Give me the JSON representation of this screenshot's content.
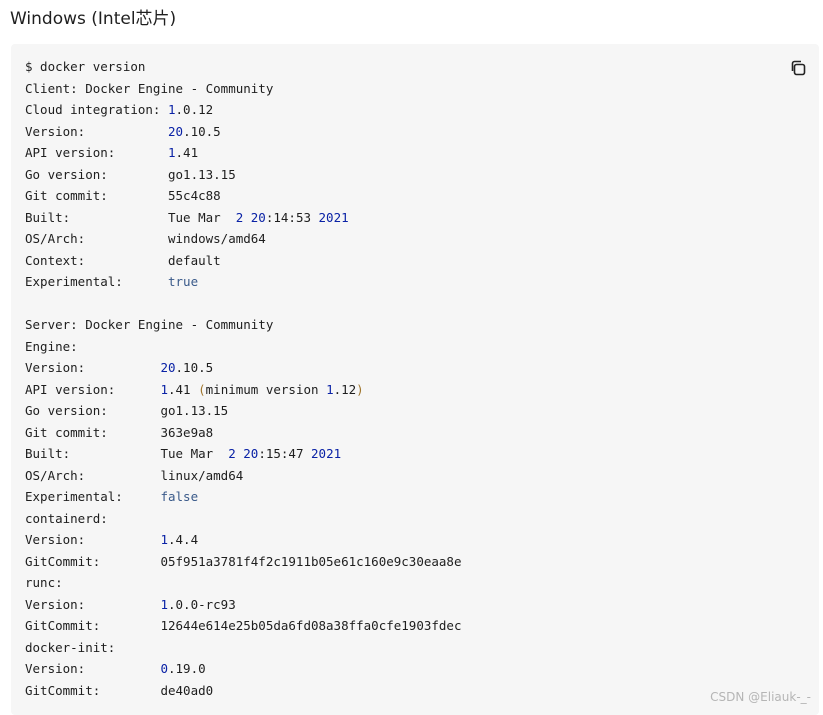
{
  "heading": "Windows (Intel芯片)",
  "copy_icon": "copy-icon",
  "colors": {
    "number": "#0a22a6",
    "boolean": "#3a5a8a",
    "paren": "#a0762d",
    "code_background": "#f6f6f6"
  },
  "code_lines": [
    [
      {
        "t": "$ docker version"
      }
    ],
    [
      {
        "t": "Client: Docker Engine - Community"
      }
    ],
    [
      {
        "t": "Cloud integration: "
      },
      {
        "t": "1",
        "k": "num"
      },
      {
        "t": ".0.12"
      }
    ],
    [
      {
        "t": "Version:           "
      },
      {
        "t": "20",
        "k": "num"
      },
      {
        "t": ".10.5"
      }
    ],
    [
      {
        "t": "API version:       "
      },
      {
        "t": "1",
        "k": "num"
      },
      {
        "t": ".41"
      }
    ],
    [
      {
        "t": "Go version:        go1.13.15"
      }
    ],
    [
      {
        "t": "Git commit:        55c4c88"
      }
    ],
    [
      {
        "t": "Built:             Tue Mar  "
      },
      {
        "t": "2",
        "k": "num"
      },
      {
        "t": " "
      },
      {
        "t": "20",
        "k": "num"
      },
      {
        "t": ":14:53 "
      },
      {
        "t": "2021",
        "k": "num"
      }
    ],
    [
      {
        "t": "OS/Arch:           windows/amd64"
      }
    ],
    [
      {
        "t": "Context:           default"
      }
    ],
    [
      {
        "t": "Experimental:      "
      },
      {
        "t": "true",
        "k": "bool"
      }
    ],
    [
      {
        "t": ""
      }
    ],
    [
      {
        "t": "Server: Docker Engine - Community"
      }
    ],
    [
      {
        "t": "Engine:"
      }
    ],
    [
      {
        "t": "Version:          "
      },
      {
        "t": "20",
        "k": "num"
      },
      {
        "t": ".10.5"
      }
    ],
    [
      {
        "t": "API version:      "
      },
      {
        "t": "1",
        "k": "num"
      },
      {
        "t": ".41 "
      },
      {
        "t": "(",
        "k": "paren"
      },
      {
        "t": "minimum version "
      },
      {
        "t": "1",
        "k": "num"
      },
      {
        "t": ".12"
      },
      {
        "t": ")",
        "k": "paren"
      }
    ],
    [
      {
        "t": "Go version:       go1.13.15"
      }
    ],
    [
      {
        "t": "Git commit:       363e9a8"
      }
    ],
    [
      {
        "t": "Built:            Tue Mar  "
      },
      {
        "t": "2",
        "k": "num"
      },
      {
        "t": " "
      },
      {
        "t": "20",
        "k": "num"
      },
      {
        "t": ":15:47 "
      },
      {
        "t": "2021",
        "k": "num"
      }
    ],
    [
      {
        "t": "OS/Arch:          linux/amd64"
      }
    ],
    [
      {
        "t": "Experimental:     "
      },
      {
        "t": "false",
        "k": "bool"
      }
    ],
    [
      {
        "t": "containerd:"
      }
    ],
    [
      {
        "t": "Version:          "
      },
      {
        "t": "1",
        "k": "num"
      },
      {
        "t": ".4.4"
      }
    ],
    [
      {
        "t": "GitCommit:        05f951a3781f4f2c1911b05e61c160e9c30eaa8e"
      }
    ],
    [
      {
        "t": "runc:"
      }
    ],
    [
      {
        "t": "Version:          "
      },
      {
        "t": "1",
        "k": "num"
      },
      {
        "t": ".0.0-rc93"
      }
    ],
    [
      {
        "t": "GitCommit:        12644e614e25b05da6fd08a38ffa0cfe1903fdec"
      }
    ],
    [
      {
        "t": "docker-init:"
      }
    ],
    [
      {
        "t": "Version:          "
      },
      {
        "t": "0",
        "k": "num"
      },
      {
        "t": ".19.0"
      }
    ],
    [
      {
        "t": "GitCommit:        de40ad0"
      }
    ]
  ],
  "watermark": "CSDN @Eliauk-_-"
}
